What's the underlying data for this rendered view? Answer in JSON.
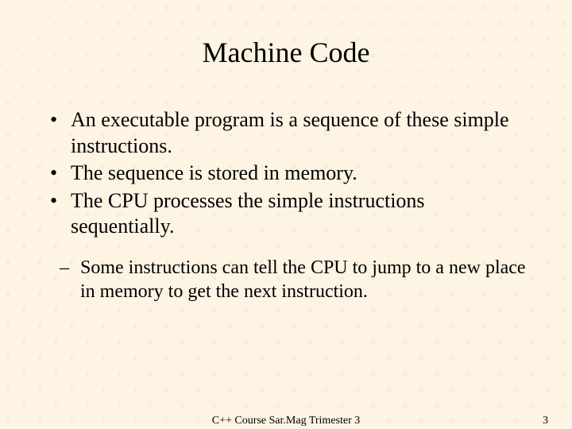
{
  "title": "Machine Code",
  "bullets": [
    "An executable program is a sequence of these simple instructions.",
    "The sequence is stored in memory.",
    "The CPU processes the simple instructions sequentially."
  ],
  "sub_bullets": [
    "Some instructions can tell the CPU to jump to a new place in memory to get the next instruction."
  ],
  "footer": {
    "center": "C++    Course Sar.Mag Trimester 3",
    "page": "3"
  }
}
